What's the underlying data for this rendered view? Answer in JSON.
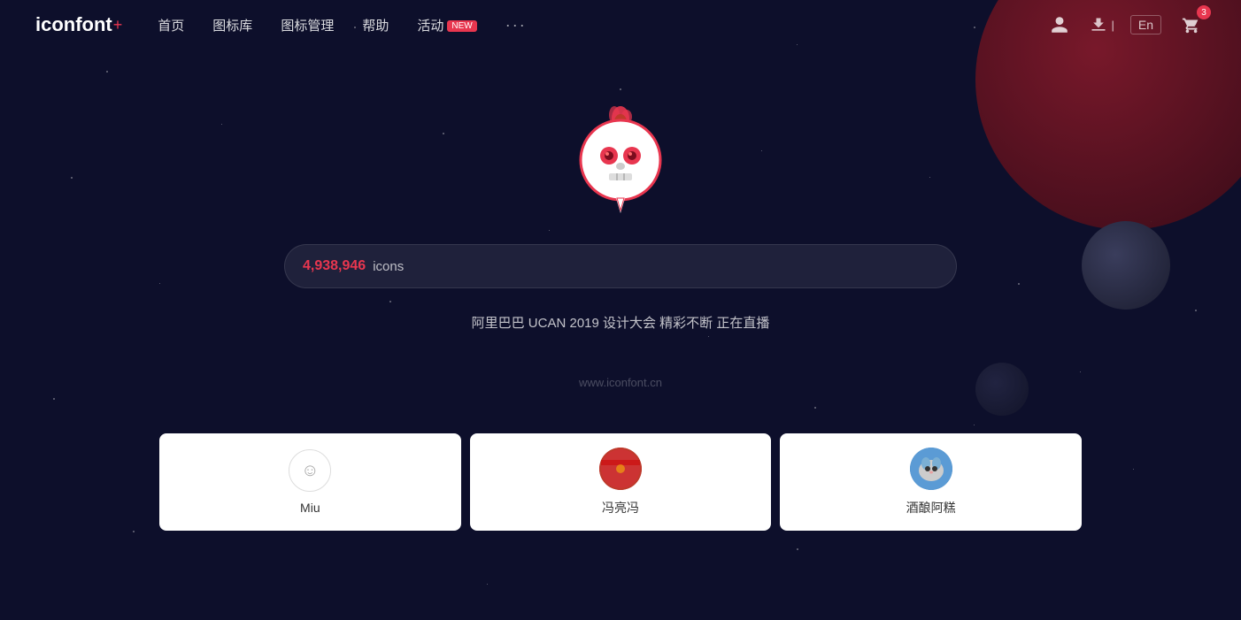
{
  "logo": {
    "text": "iconfont",
    "plus": "+"
  },
  "nav": {
    "links": [
      {
        "id": "home",
        "label": "首页",
        "badge": null
      },
      {
        "id": "library",
        "label": "图标库",
        "badge": null
      },
      {
        "id": "manage",
        "label": "图标管理",
        "badge": null
      },
      {
        "id": "help",
        "label": "帮助",
        "badge": null
      },
      {
        "id": "activity",
        "label": "活动",
        "badge": "NEW"
      }
    ],
    "more": "···",
    "lang": "En",
    "cart_count": "3"
  },
  "hero": {
    "icon_count": "4,938,946",
    "icon_label": "icons",
    "promo": "阿里巴巴 UCAN 2019 设计大会 精彩不断 正在直播",
    "url": "www.iconfont.cn"
  },
  "cards": [
    {
      "id": "miu",
      "name": "Miu",
      "type": "smiley"
    },
    {
      "id": "feng",
      "name": "冯亮冯",
      "type": "photo-red"
    },
    {
      "id": "jiu",
      "name": "酒酿阿糕",
      "type": "photo-blue"
    }
  ]
}
